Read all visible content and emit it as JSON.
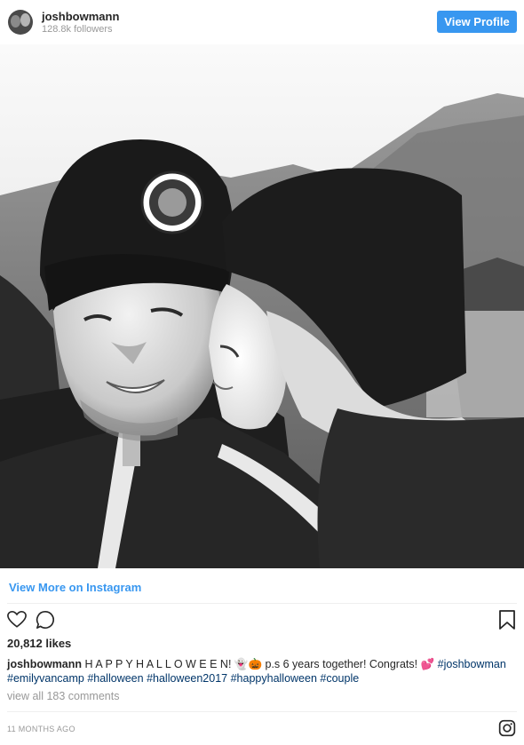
{
  "header": {
    "username": "joshbowmann",
    "followers": "128.8k followers",
    "view_profile_label": "View Profile"
  },
  "post": {
    "photo_alt": "Black and white selfie of a couple in beanies",
    "view_more_label": "View More on Instagram",
    "likes": "20,812 likes",
    "caption_user": "joshbowmann",
    "caption_text": "H A P P Y H A L L O W E E N! 👻🎃 p.s 6 years together! Congrats! 💕",
    "hashtags": [
      "#joshbowman",
      "#emilyvancamp",
      "#halloween",
      "#halloween2017",
      "#happyhalloween",
      "#couple"
    ],
    "comments_link": "view all 183 comments",
    "timestamp": "11 MONTHS AGO"
  },
  "icons": {
    "like": "heart-icon",
    "comment": "comment-icon",
    "save": "bookmark-icon",
    "brand": "instagram-icon"
  },
  "colors": {
    "accent": "#3897f0",
    "hashtag": "#003569",
    "muted": "#999999",
    "text": "#262626"
  }
}
